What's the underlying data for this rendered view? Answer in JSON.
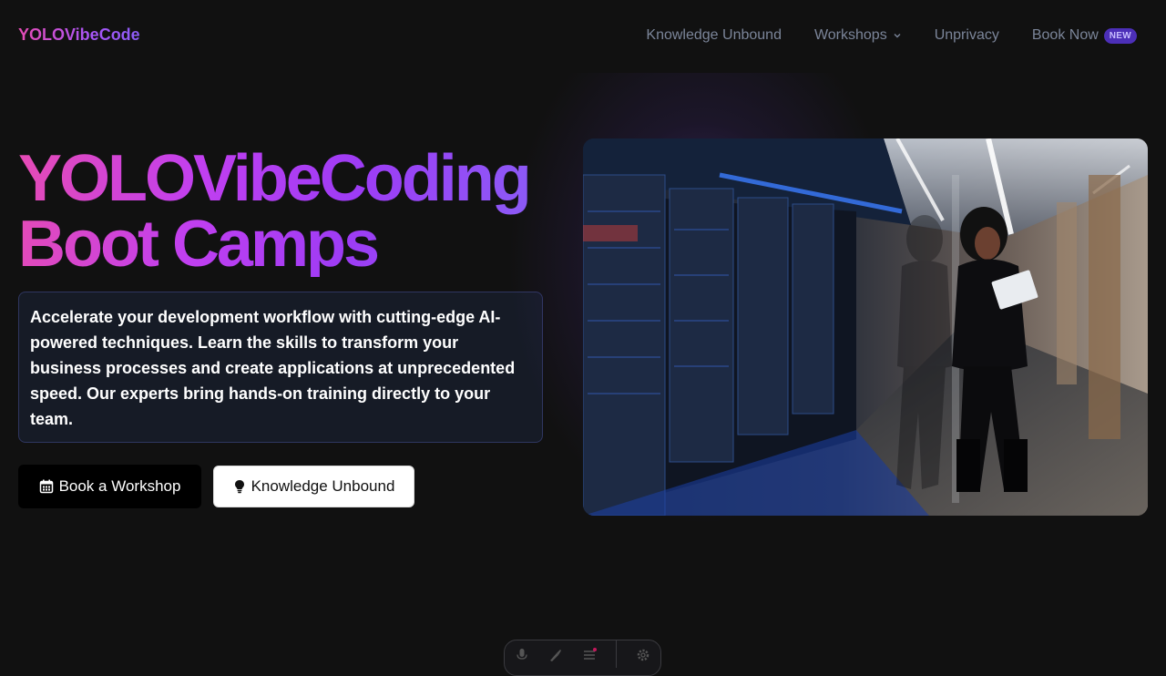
{
  "brand": {
    "logo_text": "YOLOVibeCode"
  },
  "nav": {
    "items": [
      {
        "label": "Knowledge Unbound"
      },
      {
        "label": "Workshops"
      },
      {
        "label": "Unprivacy"
      },
      {
        "label": "Book Now",
        "badge": "NEW"
      }
    ]
  },
  "hero": {
    "title_line1": "YOLOVibeCoding",
    "title_line2": "Boot Camps",
    "description": "Accelerate your development workflow with cutting-edge AI-powered techniques. Learn the skills to transform your business processes and create applications at unprecedented speed. Our experts bring hands-on training directly to your team.",
    "primary_button": "Book a Workshop",
    "secondary_button": "Knowledge Unbound",
    "primary_icon": "calendar-icon",
    "secondary_icon": "lightbulb-icon"
  },
  "colors": {
    "background": "#111111",
    "accent_pink": "#e64bb4",
    "accent_purple": "#8b5cf6",
    "badge_bg": "#4c2fb8"
  },
  "toolbar_icons": [
    "microphone-icon",
    "brush-icon",
    "menu-icon",
    "settings-icon"
  ]
}
